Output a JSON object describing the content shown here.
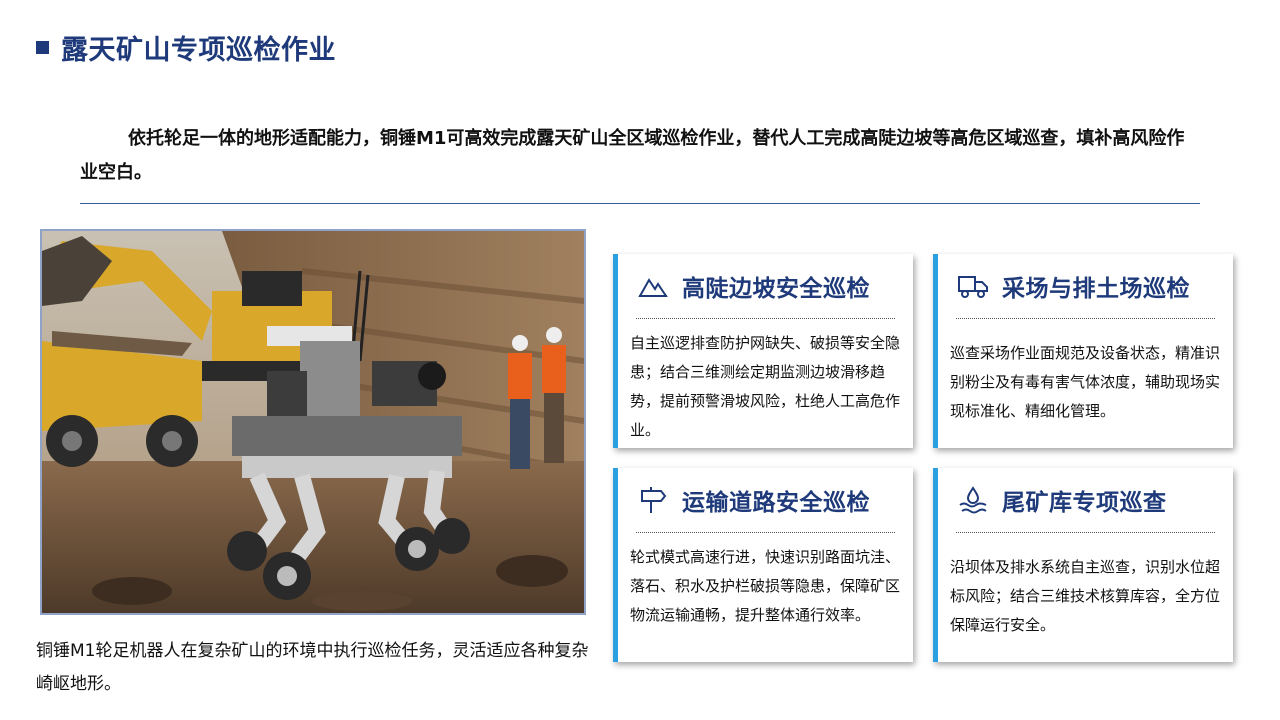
{
  "page": {
    "title": "露天矿山专项巡检作业",
    "intro": "依托轮足一体的地形适配能力，铜锤M1可高效完成露天矿山全区域巡检作业，替代人工完成高陡边坡等高危区域巡查，填补高风险作业空白。",
    "caption": "铜锤M1轮足机器人在复杂矿山的环境中执行巡检任务，灵活适应各种复杂崎岖地形。"
  },
  "cards": [
    {
      "icon": "mountain-icon",
      "title": "高陡边坡安全巡检",
      "body": "自主巡逻排查防护网缺失、破损等安全隐患；结合三维测绘定期监测边坡滑移趋势，提前预警滑坡风险，杜绝人工高危作业。"
    },
    {
      "icon": "dump-truck-icon",
      "title": "采场与排土场巡检",
      "body": "巡查采场作业面规范及设备状态，精准识别粉尘及有毒有害气体浓度，辅助现场实现标准化、精细化管理。"
    },
    {
      "icon": "road-sign-icon",
      "title": "运输道路安全巡检",
      "body": "轮式模式高速行进，快速识别路面坑洼、落石、积水及护栏破损等隐患，保障矿区物流运输通畅，提升整体通行效率。"
    },
    {
      "icon": "water-drop-icon",
      "title": "尾矿库专项巡查",
      "body": "沿坝体及排水系统自主巡查，识别水位超标风险；结合三维技术核算库容，全方位保障运行安全。"
    }
  ],
  "colors": {
    "brand": "#1f3a7a",
    "accent": "#2aa0e0"
  }
}
